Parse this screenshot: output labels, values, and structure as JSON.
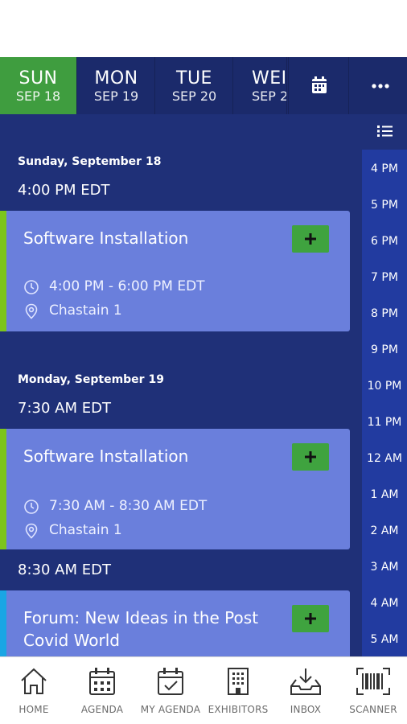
{
  "days": [
    {
      "name": "SUN",
      "date": "SEP 18"
    },
    {
      "name": "MON",
      "date": "SEP 19"
    },
    {
      "name": "TUE",
      "date": "SEP 20"
    },
    {
      "name": "WEI",
      "date": "SEP 2"
    }
  ],
  "icons": {
    "calendar": "calendar-icon",
    "more": "more-horizontal-icon",
    "list": "list-icon"
  },
  "timeline": [
    "4 PM",
    "5 PM",
    "6 PM",
    "7 PM",
    "8 PM",
    "9 PM",
    "10 PM",
    "11 PM",
    "12 AM",
    "1 AM",
    "2 AM",
    "3 AM",
    "4 AM",
    "5 AM"
  ],
  "feed": {
    "day1": "Sunday, September 18",
    "time1": "4:00 PM EDT",
    "session1": {
      "title": "Software Installation",
      "time": "4:00 PM - 6:00 PM EDT",
      "location": "Chastain 1"
    },
    "day2": "Monday, September 19",
    "time2": "7:30 AM EDT",
    "session2": {
      "title": "Software Installation",
      "time": "7:30 AM - 8:30 AM EDT",
      "location": "Chastain 1"
    },
    "time3": "8:30 AM EDT",
    "session3": {
      "title": "Forum: New Ideas in the Post Covid World"
    }
  },
  "tabs": [
    {
      "label": "HOME",
      "icon": "home-icon"
    },
    {
      "label": "AGENDA",
      "icon": "calendar-icon"
    },
    {
      "label": "MY AGENDA",
      "icon": "calendar-check-icon"
    },
    {
      "label": "EXHIBITORS",
      "icon": "building-icon"
    },
    {
      "label": "INBOX",
      "icon": "inbox-download-icon"
    },
    {
      "label": "SCANNER",
      "icon": "barcode-scanner-icon"
    }
  ],
  "colors": {
    "navy": "#1b2a6b",
    "main_bg": "#1f3078",
    "rail_bg": "#223ba0",
    "card_bg": "#6a7fdc",
    "accent_green": "#3f9d3f",
    "track_green": "#7cc51c",
    "track_blue": "#1aa6e4"
  }
}
